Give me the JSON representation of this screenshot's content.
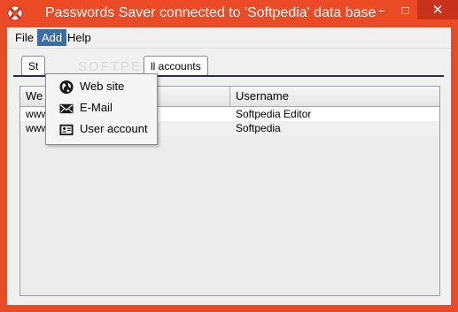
{
  "window": {
    "title": "Passwords Saver connected to 'Softpedia' data base",
    "accent_color": "#ea4a24"
  },
  "title_controls": {
    "minimize": "–",
    "maximize": "□",
    "close": "✕"
  },
  "menubar": {
    "items": [
      {
        "label": "File"
      },
      {
        "label": "Add"
      },
      {
        "label": "Help"
      }
    ]
  },
  "tabs": [
    {
      "label": "St"
    },
    {
      "label": "ll accounts"
    }
  ],
  "table": {
    "columns": [
      {
        "label": "We"
      },
      {
        "label": "Username"
      }
    ],
    "rows": [
      {
        "site": "www.softpedia.com",
        "username": "Softpedia Editor"
      },
      {
        "site": "www.softpedia.com",
        "username": "Softpedia"
      }
    ]
  },
  "add_menu": {
    "items": [
      {
        "label": "Web site",
        "icon": "globe-icon"
      },
      {
        "label": "E-Mail",
        "icon": "envelope-icon"
      },
      {
        "label": "User account",
        "icon": "id-card-icon"
      }
    ]
  },
  "watermark": "SOFTPEDIA"
}
